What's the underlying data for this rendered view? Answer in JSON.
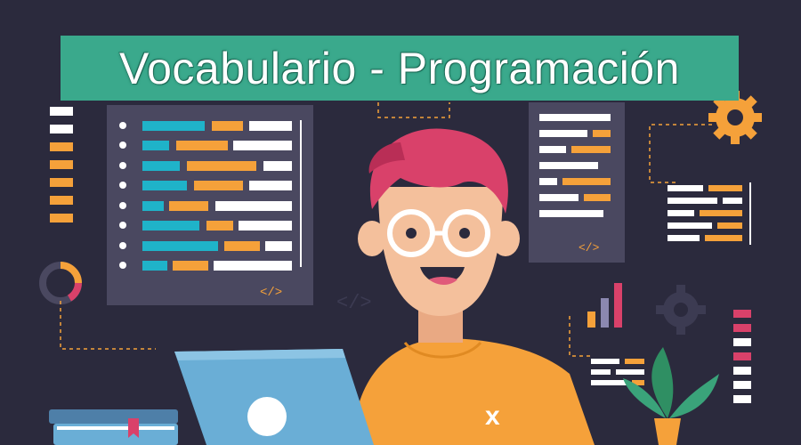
{
  "title": "Vocabulario - Programación",
  "code_tag": "</>",
  "shirt_mark": "x",
  "colors": {
    "background": "#2b2a3d",
    "panel": "#4a4860",
    "banner": "#3aa98c",
    "hair": "#d9416a",
    "shirt": "#f5a13a",
    "skin": "#f4c09c",
    "laptop": "#6aaed6",
    "code_blue": "#1fb3c9",
    "code_orange": "#f5a13a",
    "code_white": "#ffffff"
  }
}
